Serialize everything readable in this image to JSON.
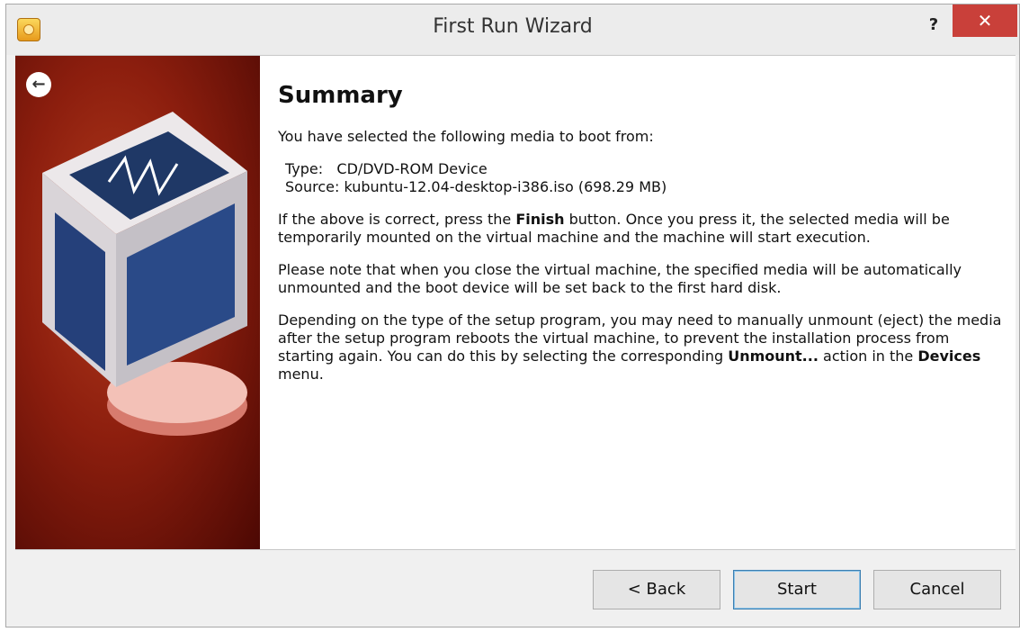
{
  "window": {
    "title": "First Run Wizard",
    "help_label": "?",
    "close_label": "✕"
  },
  "side": {
    "back_icon": "←"
  },
  "page": {
    "heading": "Summary",
    "intro": "You have selected the following media to boot from:",
    "type_label": "Type:",
    "type_value": "CD/DVD-ROM Device",
    "source_label": "Source:",
    "source_value": "kubuntu-12.04-desktop-i386.iso (698.29 MB)",
    "para1_a": "If the above is correct, press the ",
    "para1_bold": "Finish",
    "para1_b": " button. Once you press it, the selected media will be temporarily mounted on the virtual machine and the machine will start execution.",
    "para2": "Please note that when you close the virtual machine, the specified media will be automatically unmounted and the boot device will be set back to the first hard disk.",
    "para3_a": "Depending on the type of the setup program, you may need to manually unmount (eject) the media after the setup program reboots the virtual machine, to prevent the installation process from starting again. You can do this by selecting the corresponding ",
    "para3_bold1": "Unmount...",
    "para3_b": " action in the ",
    "para3_bold2": "Devices",
    "para3_c": " menu."
  },
  "buttons": {
    "back": "< Back",
    "start": "Start",
    "cancel": "Cancel"
  }
}
